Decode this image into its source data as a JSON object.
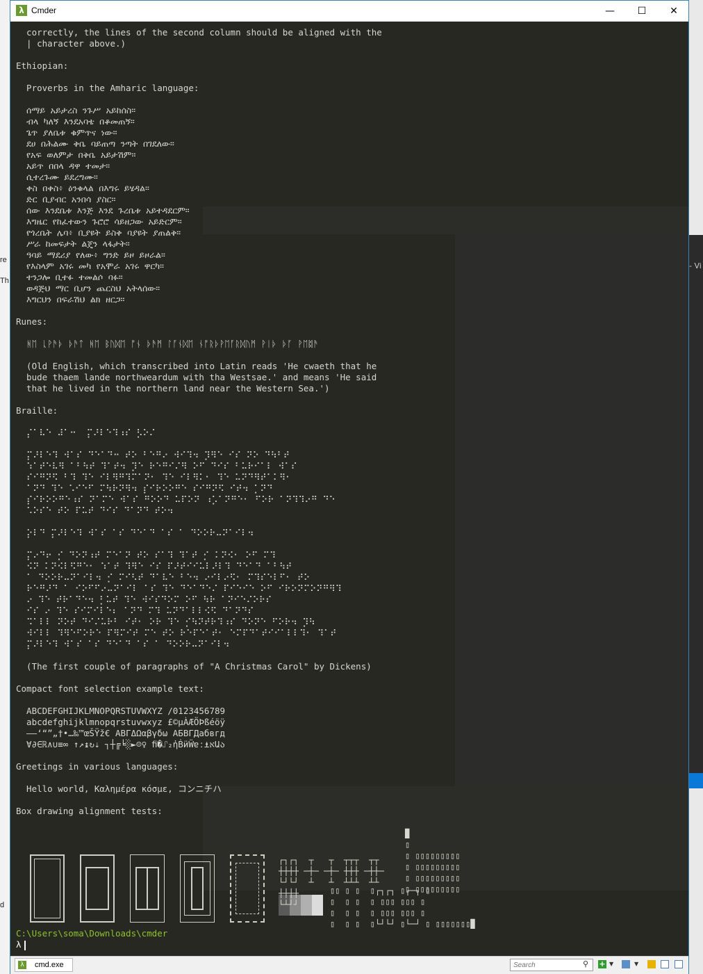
{
  "window": {
    "title": "Cmder"
  },
  "background": {
    "frag1": "re",
    "frag2": "Th",
    "frag3": "d",
    "frag4": "- Vi"
  },
  "colors": {
    "console_bg": "#272822",
    "console_text": "#d8d8d0",
    "prompt_path": "#8fc22c"
  },
  "terminal": {
    "text": "  correctly, the lines of the second column should be aligned with the\n  | character above.)\n\nEthiopian:\n\n  Proverbs in the Amharic language:\n\n  ሰማይ አይታረስ ንጉሥ አይከሰስ።\n  ብላ ካለኝ እንደአባቴ በቆመጠኝ።\n  ጌጥ ያለቤቱ ቁምጥና ነው።\n  ደሀ በሕልሙ ቅቤ ባይጠጣ ንጣት በገደለው።\n  የአፍ ወለምታ በቅቤ አይታሽም።\n  አይጥ በበላ ዳዋ ተመታ።\n  ሲተረጉሙ ይደረግሙ።\n  ቀስ በቀስ፥ ዕንቁላል በእግሩ ይሄዳል።\n  ድር ቢያብር አንበሳ ያስር።\n  ሰው እንደቤቱ እንጅ እንደ ጉረቤቱ አይተዳደርም።\n  እግዜር የከፈተውን ጉሮሮ ሳይዘጋው አይድርም።\n  የጎረቤት ሌባ፥ ቢያዩት ይስቅ ባያዩት ያጠልቅ።\n  ሥራ ከመፍታት ልጄን ላፋታት።\n  ዓባይ ማደሪያ የለው፥ ግንድ ይዞ ይዞራል።\n  የእስላም አገሩ መካ የአሞራ አገሩ ዋርካ።\n  ተንጋሎ ቢተፉ ተመልሶ ባፉ።\n  ወዳጅህ ማር ቢሆን ጨርስህ አትላሰው።\n  እግርህን በፍራሽህ ልክ ዘርጋ።\n\nRunes:\n\n  ᚻᛖ ᚳᚹᚫᚦ ᚦᚫᛏ ᚻᛖ ᛒᚢᛞᛖ ᚩᚾ ᚦᚫᛗ ᛚᚪᚾᛞᛖ ᚾᚩᚱᚦᚹᛖᚪᚱᛞᚢᛗ ᚹᛁᚦ ᚦᚪ ᚹᛖᛥᚫ\n\n  (Old English, which transcribed into Latin reads 'He cwaeth that he\n  bude thaem lande northweardum with tha Westsae.' and means 'He said\n  that he lived in the northern land near the Western Sea.')\n\nBraille:\n\n  ⡌⠁⠧⠑ ⠼⠁⠒  ⡍⠜⠇⠑⠹⠰⠎ ⡣⠕⠌\n\n  ⡍⠜⠇⠑⠹ ⠺⠁⠎ ⠙⠑⠁⠙⠒ ⠞⠕ ⠃⠑⠛⠔ ⠺⠊⠹⠲ ⡹⠻⠑ ⠊⠎ ⠝⠕ ⠙⠳⠃⠞\n  ⠱⠁⠞⠑⠧⠻ ⠁⠃⠳⠞ ⠹⠁⠞⠲ ⡹⠑ ⠗⠑⠛⠊⠌⠻ ⠕⠋ ⠙⠊⠎ ⠃⠥⠗⠊⠁⠇ ⠺⠁⠎\n  ⠎⠊⠛⠝⠫ ⠃⠹ ⠹⠑ ⠊⠇⠻⠛⠹⠍⠁⠝⠂ ⠹⠑ ⠊⠇⠻⠅⠂ ⠹⠑ ⠥⠝⠙⠻⠞⠁⠅⠻⠂\n  ⠁⠝⠙ ⠹⠑ ⠡⠊⠑⠋ ⠍⠳⠗⠝⠻⠲ ⡎⠊⠗⠕⠕⠛⠑ ⠎⠊⠛⠝⠫ ⠊⠞⠲ ⡁⠝⠙\n  ⡎⠊⠗⠕⠕⠛⠑⠰⠎ ⠝⠁⠍⠑ ⠺⠁⠎ ⠛⠕⠕⠙ ⠥⠏⠕⠝ ⠰⡡⠁⠝⠛⠑⠂ ⠋⠕⠗ ⠁⠝⠹⠹⠔⠛ ⠙⠑\n  ⠡⠕⠎⠑ ⠞⠕ ⠏⠥⠞ ⠙⠊⠎ ⠙⠁⠝⠙ ⠞⠕⠲\n\n  ⡕⠇⠙ ⡍⠜⠇⠑⠹ ⠺⠁⠎ ⠁⠎ ⠙⠑⠁⠙ ⠁⠎ ⠁ ⠙⠕⠕⠗⠤⠝⠁⠊⠇⠲\n\n  ⡍⠔⠙⠖ ⡊ ⠙⠕⠝⠰⠞ ⠍⠑⠁⠝ ⠞⠕ ⠎⠁⠹ ⠹⠁⠞ ⡊ ⠅⠝⠪⠂ ⠕⠋ ⠍⠹\n  ⠪⠝ ⠅⠝⠪⠇⠫⠛⠑⠂ ⠱⠁⠞ ⠹⠻⠑ ⠊⠎ ⠏⠜⠞⠊⠊⠥⠇⠜⠇⠹ ⠙⠑⠁⠙ ⠁⠃⠳⠞\n  ⠁ ⠙⠕⠕⠗⠤⠝⠁⠊⠇⠲ ⡊ ⠍⠊⠣⠞ ⠙⠁⠧⠑ ⠃⠑⠲ ⠔⠊⠇⠔⠫⠂ ⠍⠹⠎⠑⠇⠋⠂ ⠞⠕\n  ⠗⠑⠛⠜⠙ ⠁ ⠊⠕⠋⠋⠔⠤⠝⠁⠊⠇ ⠁⠎ ⠹⠑ ⠙⠑⠁⠙⠑⠌ ⠏⠊⠑⠊⠑ ⠕⠋ ⠊⠗⠕⠝⠍⠕⠝⠛⠻⠹\n  ⠔ ⠹⠑ ⠞⠗⠁⠙⠑⠲ ⡃⠥⠞ ⠹⠑ ⠺⠊⠎⠙⠕⠍ ⠕⠋ ⠳⠗ ⠁⠝⠊⠑⠌⠕⠗⠎\n  ⠊⠎ ⠔ ⠹⠑ ⠎⠊⠍⠊⠇⠑⠆ ⠁⠝⠙ ⠍⠹ ⠥⠝⠙⠁⠇⠇⠪⠫ ⠙⠁⠝⠙⠎\n  ⠩⠁⠇⠇ ⠝⠕⠞ ⠙⠊⠌⠥⠗⠃ ⠊⠞⠂ ⠕⠗ ⠹⠑ ⡊⠳⠝⠞⠗⠹⠰⠎ ⠙⠕⠝⠑ ⠋⠕⠗⠲ ⡹⠳\n  ⠺⠊⠇⠇ ⠹⠻⠑⠋⠕⠗⠑ ⠏⠻⠍⠊⠞ ⠍⠑ ⠞⠕ ⠗⠑⠏⠑⠁⠞⠂ ⠑⠍⠏⠙⠁⠞⠊⠊⠁⠇⠇⠹⠂ ⠹⠁⠞\n  ⡍⠜⠇⠑⠹ ⠺⠁⠎ ⠁⠎ ⠙⠑⠁⠙ ⠁⠎ ⠁ ⠙⠕⠕⠗⠤⠝⠁⠊⠇⠲\n\n  (The first couple of paragraphs of \"A Christmas Carol\" by Dickens)\n\nCompact font selection example text:\n\n  ABCDEFGHIJKLMNOPQRSTUVWXYZ /0123456789\n  abcdefghijklmnopqrstuvwxyz £©µÀÆÖÞßéöÿ\n  –—‘“”„†•…‰™œŠŸž€ ΑΒΓΔΩαβγδω АБВГДабвгд\n  ∀∂∈ℝ∧∪≡∞ ↑↗↨↻⇣ ┐┼╔╘░►☺♀ ﬁ�⑀₂ἠḂӥẄɐː⍎אԱა\n\nGreetings in various languages:\n\n  Hello world, Καλημέρα κόσμε, コンニチハ\n\nBox drawing alignment tests:",
    "box_dots_1": "▉\n▯\n▯ ▯▯▯▯▯▯▯▯▯\n▯ ▯▯▯▯▯▯▯▯▯\n▯ ▯▯▯▯▯▯▯▯▯\n▯ ▯▯▯▯▯▯▯▯▯",
    "box_dots_2": "┌┐┌┐  ┬   ┬  ┬┬┬  ┬┬\n┼┼┼┼ ─┼─ ─┼─ ┼┼┼ ─┼┼─\n└┘└┘  ┴   ┴  ┴┴┴  ┴┴\n┼┼┼┼\n└┴┘┘",
    "box_dots_3": "▯▯ ▯ ▯  ▯┌┐┌┐ ▯┌─┐ ▯\n▯  ▯ ▯  ▯ ▯▯▯ ▯▯▯ ▯\n▯  ▯ ▯  ▯ ▯▯▯ ▯▯▯ ▯\n▯  ▯ ▯  ▯└┘└┘ ▯└─┘ ▯ ▯▯▯▯▯▯▯▉",
    "prompt_path": "C:\\Users\\soma\\Downloads\\cmder",
    "prompt_symbol": "λ"
  },
  "statusbar": {
    "tab_icon": "λ",
    "tab_label": "cmd.exe",
    "search_placeholder": "Search"
  }
}
